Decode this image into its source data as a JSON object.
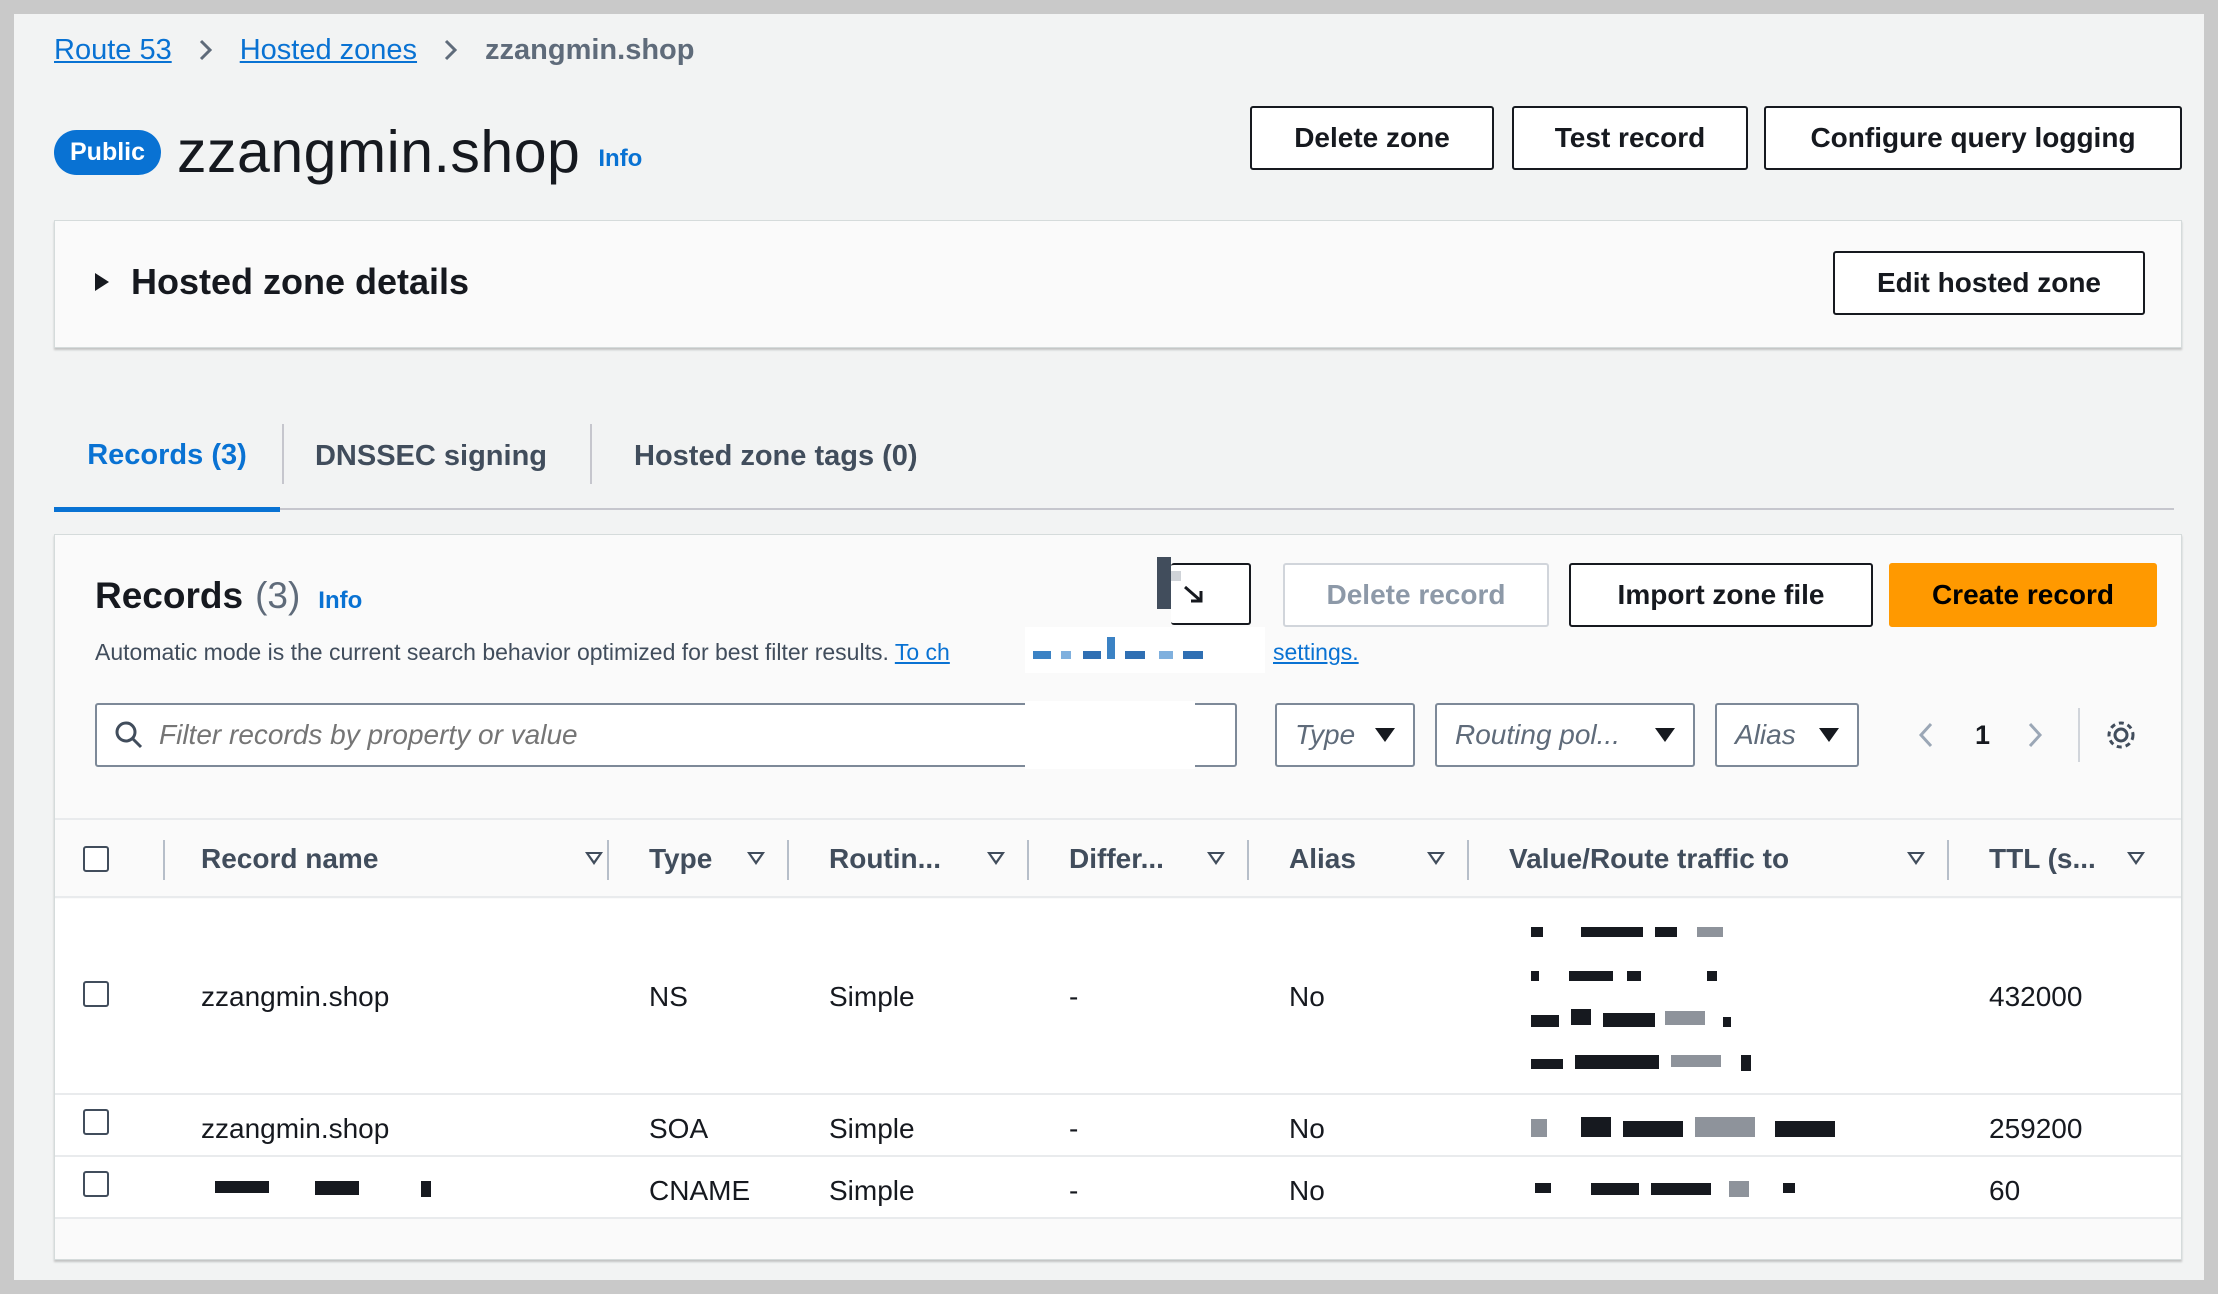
{
  "breadcrumb": {
    "items": [
      "Route 53",
      "Hosted zones"
    ],
    "current": "zzangmin.shop"
  },
  "header": {
    "badge": "Public",
    "title": "zzangmin.shop",
    "info": "Info"
  },
  "actions": {
    "delete_zone": "Delete zone",
    "test_record": "Test record",
    "configure_logging": "Configure query logging"
  },
  "details": {
    "title": "Hosted zone details",
    "edit": "Edit hosted zone"
  },
  "tabs": [
    {
      "label": "Records (3)"
    },
    {
      "label": "DNSSEC signing"
    },
    {
      "label": "Hosted zone tags (0)"
    }
  ],
  "records": {
    "title": "Records",
    "count": "(3)",
    "info": "Info",
    "desc": "Automatic mode is the current search behavior optimized for best filter results.",
    "desc_link_start": "To ch",
    "desc_link_end": "settings.",
    "delete_record": "Delete record",
    "import_zone": "Import zone file",
    "create_record": "Create record",
    "filter_placeholder": "Filter records by property or value",
    "filters": {
      "type": "Type",
      "routing": "Routing pol...",
      "alias": "Alias"
    },
    "page": "1",
    "columns": [
      "Record name",
      "Type",
      "Routin...",
      "Differ...",
      "Alias",
      "Value/Route traffic to",
      "TTL (s..."
    ],
    "rows": [
      {
        "name": "zzangmin.shop",
        "type": "NS",
        "routing": "Simple",
        "differ": "-",
        "alias": "No",
        "ttl": "432000"
      },
      {
        "name": "zzangmin.shop",
        "type": "SOA",
        "routing": "Simple",
        "differ": "-",
        "alias": "No",
        "ttl": "259200"
      },
      {
        "name": "",
        "type": "CNAME",
        "routing": "Simple",
        "differ": "-",
        "alias": "No",
        "ttl": "60"
      }
    ]
  },
  "colors": {
    "accent": "#0972d3",
    "primary_button": "#ff9900",
    "text": "#16191f"
  }
}
